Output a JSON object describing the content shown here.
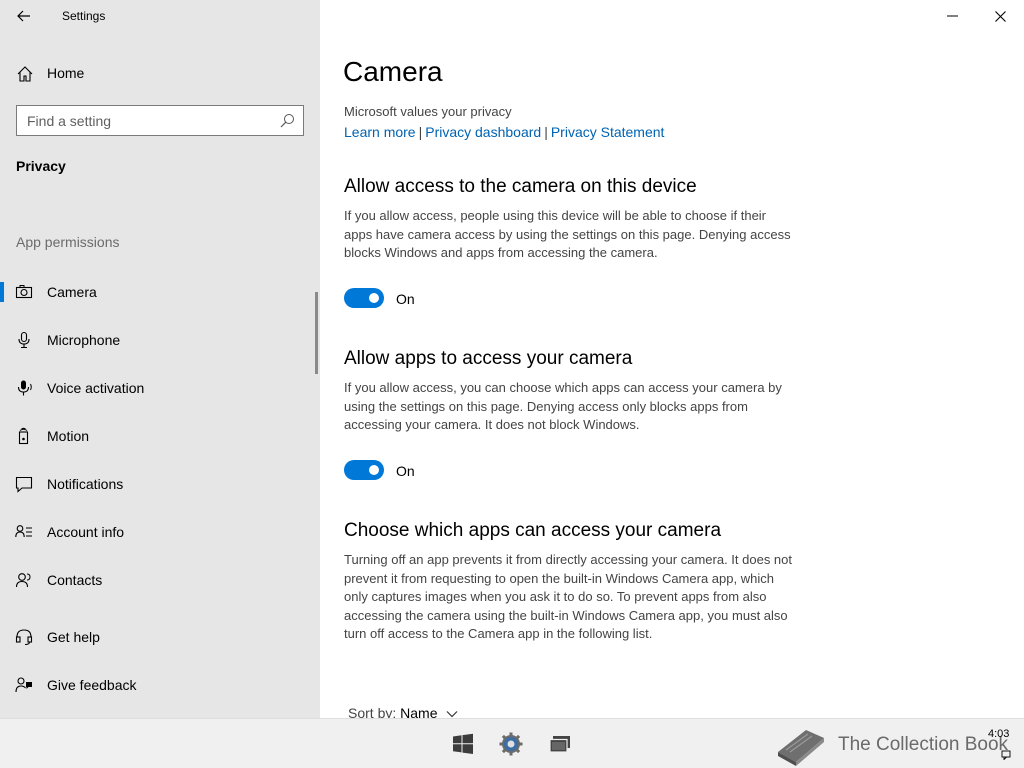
{
  "window": {
    "title": "Settings",
    "controls": {
      "minimize": "minimize-icon",
      "close": "close-icon"
    }
  },
  "sidebar": {
    "home_label": "Home",
    "search_placeholder": "Find a setting",
    "section_title": "Privacy",
    "group_title": "App permissions",
    "items": [
      {
        "label": "Camera",
        "icon": "camera-icon",
        "selected": true
      },
      {
        "label": "Microphone",
        "icon": "microphone-icon",
        "selected": false
      },
      {
        "label": "Voice activation",
        "icon": "voice-activation-icon",
        "selected": false
      },
      {
        "label": "Motion",
        "icon": "motion-icon",
        "selected": false
      },
      {
        "label": "Notifications",
        "icon": "notifications-icon",
        "selected": false
      },
      {
        "label": "Account info",
        "icon": "account-info-icon",
        "selected": false
      },
      {
        "label": "Contacts",
        "icon": "contacts-icon",
        "selected": false
      }
    ],
    "help_items": [
      {
        "label": "Get help",
        "icon": "get-help-icon"
      },
      {
        "label": "Give feedback",
        "icon": "give-feedback-icon"
      }
    ]
  },
  "main": {
    "title": "Camera",
    "privacy_note": "Microsoft values your privacy",
    "links": [
      "Learn more",
      "Privacy dashboard",
      "Privacy Statement"
    ],
    "separator": "|",
    "sections": [
      {
        "heading": "Allow access to the camera on this device",
        "description": "If you allow access, people using this device will be able to choose if their apps have camera access by using the settings on this page. Denying access blocks Windows and apps from accessing the camera.",
        "toggle_label": "On",
        "toggle_on": true
      },
      {
        "heading": "Allow apps to access your camera",
        "description": "If you allow access, you can choose which apps can access your camera by using the settings on this page. Denying access only blocks apps from accessing your camera. It does not block Windows.",
        "toggle_label": "On",
        "toggle_on": true
      },
      {
        "heading": "Choose which apps can access your camera",
        "description": "Turning off an app prevents it from directly accessing your camera. It does not prevent it from requesting to open the built-in Windows Camera app, which only captures images when you ask it to do so. To prevent apps from also accessing the camera using the built-in Windows Camera app, you must also turn off access to the Camera app in the following list."
      }
    ],
    "sort_label": "Sort by:",
    "sort_value": "Name"
  },
  "taskbar": {
    "watermark": "The Collection Book",
    "clock": "4:03",
    "icons": [
      "windows-start-icon",
      "settings-gear-icon",
      "task-view-icon",
      "notification-icon"
    ]
  },
  "colors": {
    "accent": "#0078d7",
    "link": "#0063b1",
    "sidebar_bg": "#e6e6e6",
    "taskbar_bg": "#f0f0f0"
  }
}
